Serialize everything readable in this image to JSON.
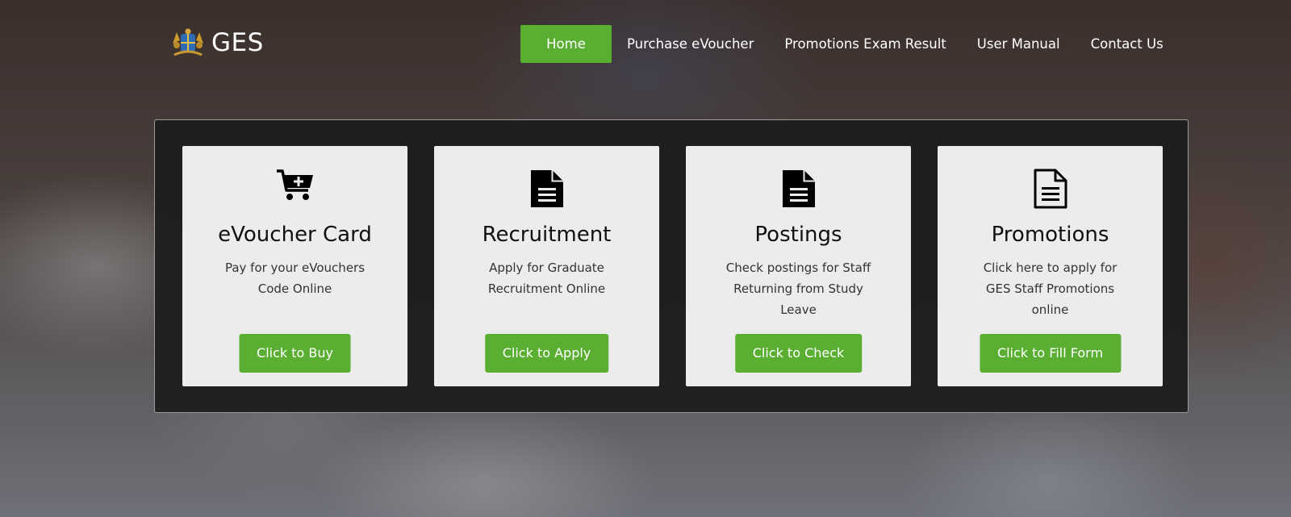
{
  "brand": {
    "name": "GES",
    "logo_icon": "ghana-coat-of-arms-icon"
  },
  "nav": {
    "items": [
      {
        "label": "Home",
        "active": true
      },
      {
        "label": "Purchase eVoucher",
        "active": false
      },
      {
        "label": "Promotions Exam Result",
        "active": false
      },
      {
        "label": "User Manual",
        "active": false
      },
      {
        "label": "Contact Us",
        "active": false
      }
    ]
  },
  "cards": [
    {
      "icon": "cart-plus-icon",
      "title": "eVoucher Card",
      "description": "Pay for your eVouchers Code Online",
      "button": "Click to Buy"
    },
    {
      "icon": "document-icon",
      "title": "Recruitment",
      "description": "Apply for Graduate Recruitment Online",
      "button": "Click to Apply"
    },
    {
      "icon": "document-icon",
      "title": "Postings",
      "description": "Check postings for Staff Returning from Study Leave",
      "button": "Click to Check"
    },
    {
      "icon": "document-outline-icon",
      "title": "Promotions",
      "description": "Click here to apply for GES Staff Promotions online",
      "button": "Click to Fill Form"
    }
  ],
  "colors": {
    "accent_green": "#5aaf32",
    "panel_bg": "#1c1c1c",
    "card_bg": "#ececec"
  }
}
